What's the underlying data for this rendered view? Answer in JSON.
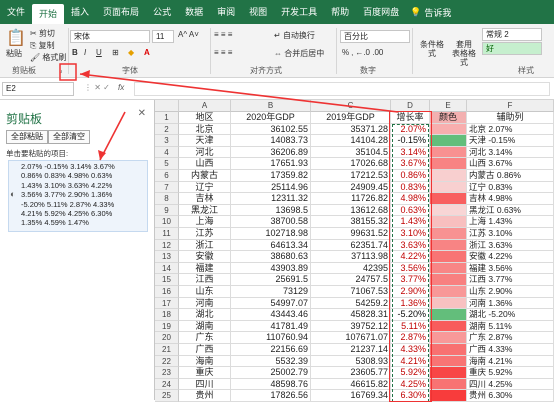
{
  "tabs": [
    "文件",
    "开始",
    "插入",
    "页面布局",
    "公式",
    "数据",
    "审阅",
    "视图",
    "开发工具",
    "帮助",
    "百度网盘"
  ],
  "tell_me": "告诉我",
  "ribbon": {
    "clipboard": {
      "paste": "粘贴",
      "cut": "剪切",
      "copy": "复制",
      "format_painter": "格式刷",
      "group": "剪贴板"
    },
    "font": {
      "name": "宋体",
      "size": "11",
      "group": "字体"
    },
    "alignment": {
      "wrap": "自动换行",
      "merge": "合并后居中",
      "group": "对齐方式"
    },
    "number": {
      "format": "百分比",
      "group": "数字"
    },
    "styles": {
      "conditional": "条件格式",
      "table": "套用\n表格格式",
      "normal2": "常规 2",
      "good": "好",
      "group": "样式"
    }
  },
  "formula_bar": {
    "name_box": "E2",
    "fx": "fx"
  },
  "clipboard_pane": {
    "title": "剪贴板",
    "paste_all": "全部粘贴",
    "clear_all": "全部清空",
    "hint": "单击要粘贴的项目:",
    "item_lines": [
      "2.07% -0.15% 3.14% 3.67%",
      "0.86% 0.83% 4.98% 0.63%",
      "1.43% 3.10% 3.63% 4.22%",
      "3.56% 3.77% 2.90% 1.36%",
      "-5.20% 5.11% 2.87% 4.33%",
      "4.21% 5.92% 4.25% 6.30%",
      "1.35% 4.59% 1.47%"
    ]
  },
  "columns": [
    "A",
    "B",
    "C",
    "D",
    "E",
    "F"
  ],
  "header_row": {
    "a": "地区",
    "b": "2020年GDP",
    "c": "2019年GDP",
    "d": "增长率",
    "e": "颜色",
    "f": "辅助列"
  },
  "rows": [
    {
      "n": "2",
      "a": "北京",
      "b": "36102.55",
      "c": "35371.28",
      "d": "2.07%",
      "f": "北京 2.07%"
    },
    {
      "n": "3",
      "a": "天津",
      "b": "14083.73",
      "c": "14104.28",
      "d": "-0.15%",
      "f": "天津 -0.15%"
    },
    {
      "n": "4",
      "a": "河北",
      "b": "36206.89",
      "c": "35104.5",
      "d": "3.14%",
      "f": "河北 3.14%"
    },
    {
      "n": "5",
      "a": "山西",
      "b": "17651.93",
      "c": "17026.68",
      "d": "3.67%",
      "f": "山西 3.67%"
    },
    {
      "n": "6",
      "a": "内蒙古",
      "b": "17359.82",
      "c": "17212.53",
      "d": "0.86%",
      "f": "内蒙古 0.86%"
    },
    {
      "n": "7",
      "a": "辽宁",
      "b": "25114.96",
      "c": "24909.45",
      "d": "0.83%",
      "f": "辽宁 0.83%"
    },
    {
      "n": "8",
      "a": "吉林",
      "b": "12311.32",
      "c": "11726.82",
      "d": "4.98%",
      "f": "吉林 4.98%"
    },
    {
      "n": "9",
      "a": "黑龙江",
      "b": "13698.5",
      "c": "13612.68",
      "d": "0.63%",
      "f": "黑龙江 0.63%"
    },
    {
      "n": "10",
      "a": "上海",
      "b": "38700.58",
      "c": "38155.32",
      "d": "1.43%",
      "f": "上海 1.43%"
    },
    {
      "n": "11",
      "a": "江苏",
      "b": "102718.98",
      "c": "99631.52",
      "d": "3.10%",
      "f": "江苏 3.10%"
    },
    {
      "n": "12",
      "a": "浙江",
      "b": "64613.34",
      "c": "62351.74",
      "d": "3.63%",
      "f": "浙江 3.63%"
    },
    {
      "n": "13",
      "a": "安徽",
      "b": "38680.63",
      "c": "37113.98",
      "d": "4.22%",
      "f": "安徽 4.22%"
    },
    {
      "n": "14",
      "a": "福建",
      "b": "43903.89",
      "c": "42395",
      "d": "3.56%",
      "f": "福建 3.56%"
    },
    {
      "n": "15",
      "a": "江西",
      "b": "25691.5",
      "c": "24757.5",
      "d": "3.77%",
      "f": "江西 3.77%"
    },
    {
      "n": "16",
      "a": "山东",
      "b": "73129",
      "c": "71067.53",
      "d": "2.90%",
      "f": "山东 2.90%"
    },
    {
      "n": "17",
      "a": "河南",
      "b": "54997.07",
      "c": "54259.2",
      "d": "1.36%",
      "f": "河南 1.36%"
    },
    {
      "n": "18",
      "a": "湖北",
      "b": "43443.46",
      "c": "45828.31",
      "d": "-5.20%",
      "f": "湖北 -5.20%"
    },
    {
      "n": "19",
      "a": "湖南",
      "b": "41781.49",
      "c": "39752.12",
      "d": "5.11%",
      "f": "湖南 5.11%"
    },
    {
      "n": "20",
      "a": "广东",
      "b": "110760.94",
      "c": "107671.07",
      "d": "2.87%",
      "f": "广东 2.87%"
    },
    {
      "n": "21",
      "a": "广西",
      "b": "22156.69",
      "c": "21237.14",
      "d": "4.33%",
      "f": "广西 4.33%"
    },
    {
      "n": "22",
      "a": "海南",
      "b": "5532.39",
      "c": "5308.93",
      "d": "4.21%",
      "f": "海南 4.21%"
    },
    {
      "n": "23",
      "a": "重庆",
      "b": "25002.79",
      "c": "23605.77",
      "d": "5.92%",
      "f": "重庆 5.92%"
    },
    {
      "n": "24",
      "a": "四川",
      "b": "48598.76",
      "c": "46615.82",
      "d": "4.25%",
      "f": "四川 4.25%"
    },
    {
      "n": "25",
      "a": "贵州",
      "b": "17826.56",
      "c": "16769.34",
      "d": "6.30%",
      "f": "贵州 6.30%"
    }
  ],
  "colors": {
    "excel_green": "#217346",
    "annotation_red": "#e33",
    "bar_green": "#63be7b"
  }
}
